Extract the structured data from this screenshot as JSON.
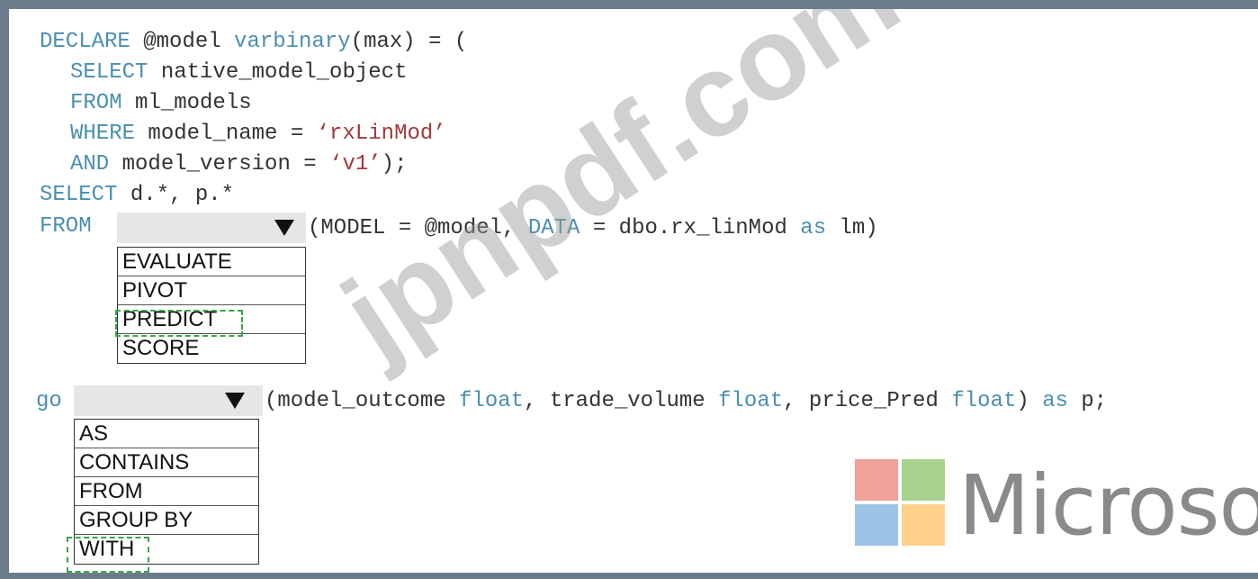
{
  "code": {
    "line1": {
      "kw1": "DECLARE",
      "t1": " @model ",
      "kw2": "varbinary",
      "t2": "(max) = ("
    },
    "line2": {
      "kw": "SELECT",
      "t": " native_model_object"
    },
    "line3": {
      "kw": "FROM",
      "t": " ml_models"
    },
    "line4": {
      "kw": "WHERE",
      "t": " model_name = ",
      "str": "‘rxLinMod’"
    },
    "line5": {
      "kw": "AND",
      "t": " model_version = ",
      "str": "‘v1’",
      "t2": ");"
    },
    "line6": {
      "kw": "SELECT",
      "t": " d.*, p.*"
    },
    "line7": {
      "kw": "FROM"
    },
    "line7_tail": {
      "t1": "(MODEL = @model, ",
      "kw1": "DATA",
      "t2": " = dbo.rx_linMod ",
      "kw2": "as",
      "t3": " lm)"
    },
    "line8": {
      "kw": "go"
    },
    "line8_tail": {
      "t1": "(model_outcome ",
      "kw1": "float",
      "t2": ", trade_volume ",
      "kw2": "float",
      "t3": ", price_Pred ",
      "kw3": "float",
      "t4": ") ",
      "kw4": "as",
      "t5": " p;"
    }
  },
  "dropdown1": {
    "options": [
      "EVALUATE",
      "PIVOT",
      "PREDICT",
      "SCORE"
    ],
    "selected": "PREDICT"
  },
  "dropdown2": {
    "options": [
      "AS",
      "CONTAINS",
      "FROM",
      "GROUP BY",
      "WITH"
    ],
    "selected": "WITH"
  },
  "watermark": {
    "text": "jpnpdf.com"
  },
  "logo": {
    "text": "Microsoft",
    "colors": {
      "red": "#f0a19a",
      "green": "#a9d18e",
      "blue": "#9dc3e6",
      "yellow": "#ffd08a"
    }
  }
}
